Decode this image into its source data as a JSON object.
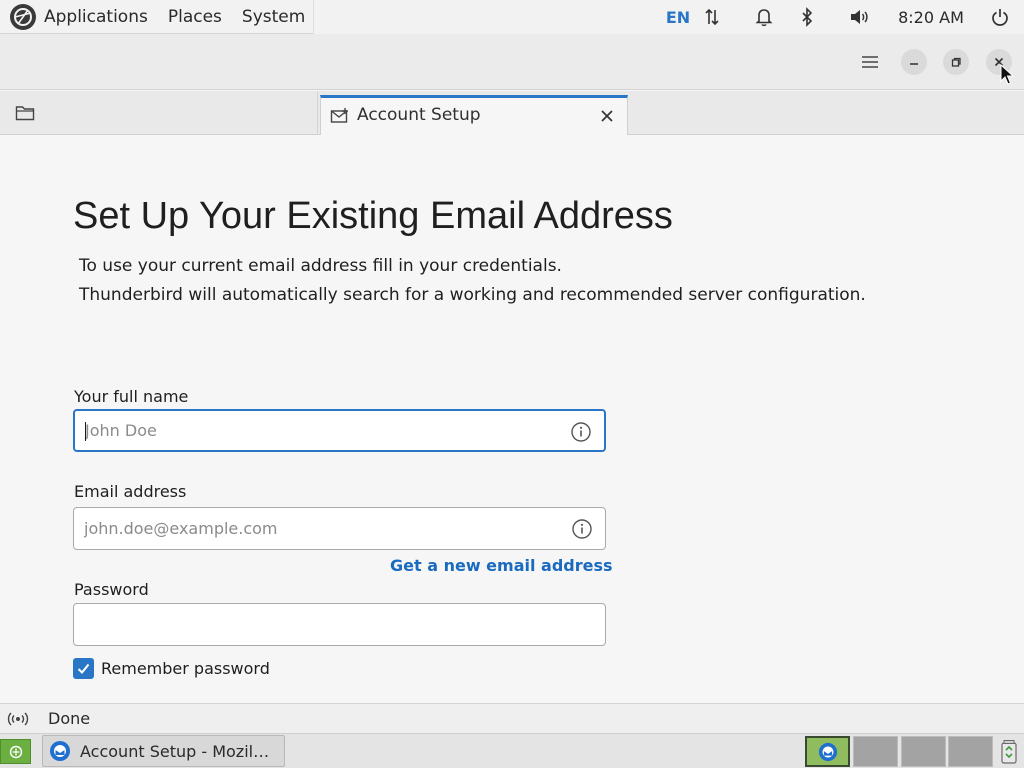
{
  "top_panel": {
    "menu": {
      "applications": "Applications",
      "places": "Places",
      "system": "System"
    },
    "tray": {
      "language": "EN",
      "clock": "8:20 AM"
    },
    "icons": [
      "distro-logo",
      "network-icon",
      "bell-icon",
      "bluetooth-icon",
      "volume-icon",
      "power-icon"
    ]
  },
  "titlebar": {
    "icons": [
      "hamburger-menu-icon",
      "minimize-icon",
      "restore-icon",
      "close-icon"
    ]
  },
  "tabs": [
    {
      "icon": "folder-icon",
      "label": ""
    },
    {
      "icon": "envelope-icon",
      "label": "Account Setup",
      "active": true
    }
  ],
  "account_setup": {
    "title": "Set Up Your Existing Email Address",
    "description_1": "To use your current email address fill in your credentials.",
    "description_2": "Thunderbird will automatically search for a working and recommended server configuration.",
    "full_name": {
      "label": "Your full name",
      "value": "",
      "placeholder": "John Doe"
    },
    "email": {
      "label": "Email address",
      "value": "",
      "placeholder": "john.doe@example.com"
    },
    "new_email_link": "Get a new email address",
    "password": {
      "label": "Password",
      "value": ""
    },
    "remember_password": {
      "label": "Remember password",
      "checked": true
    }
  },
  "status_bar": {
    "text": "Done"
  },
  "taskbar": {
    "task_label": "Account Setup - Mozil…",
    "workspaces": 4,
    "active_workspace": 1
  },
  "colors": {
    "accent": "#2a76c6",
    "link": "#1a6bc0",
    "show_desktop": "#6aaf3f"
  }
}
